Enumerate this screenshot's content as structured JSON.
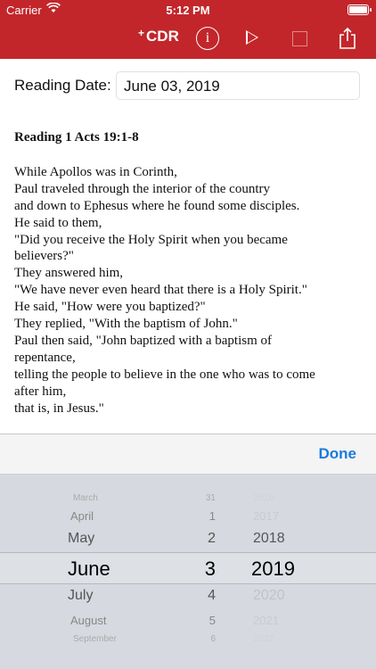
{
  "status_bar": {
    "carrier": "Carrier",
    "time": "5:12 PM"
  },
  "toolbar": {
    "logo_plus": "+",
    "logo": "CDR",
    "info": "i"
  },
  "reading_date": {
    "label": "Reading Date:",
    "value": "June 03, 2019"
  },
  "reading": {
    "title": "Reading 1 Acts 19:1-8",
    "lines": [
      "While Apollos was in Corinth,",
      "Paul traveled through the interior of the country",
      "and down to Ephesus where he found some disciples.",
      "He said to them,",
      "\"Did you receive the Holy Spirit when you became",
      "believers?\"",
      "They answered him,",
      "\"We have never even heard that there is a Holy Spirit.\"",
      "He said, \"How were you baptized?\"",
      "They replied, \"With the baptism of John.\"",
      "Paul then said, \"John baptized with a baptism of",
      "repentance,",
      "telling the people to believe in the one who was to come",
      "after him,",
      "that is, in Jesus.\""
    ]
  },
  "picker": {
    "done": "Done",
    "months": [
      "March",
      "April",
      "May",
      "June",
      "July",
      "August",
      "September"
    ],
    "days": [
      "31",
      "1",
      "2",
      "3",
      "4",
      "5",
      "6"
    ],
    "years": [
      "2016",
      "2017",
      "2018",
      "2019",
      "2020",
      "2021",
      "2022"
    ],
    "selected": {
      "month": "June",
      "day": "3",
      "year": "2019"
    }
  },
  "colors": {
    "nav_bar": "#c2262b",
    "accent": "#1a7bdc"
  }
}
